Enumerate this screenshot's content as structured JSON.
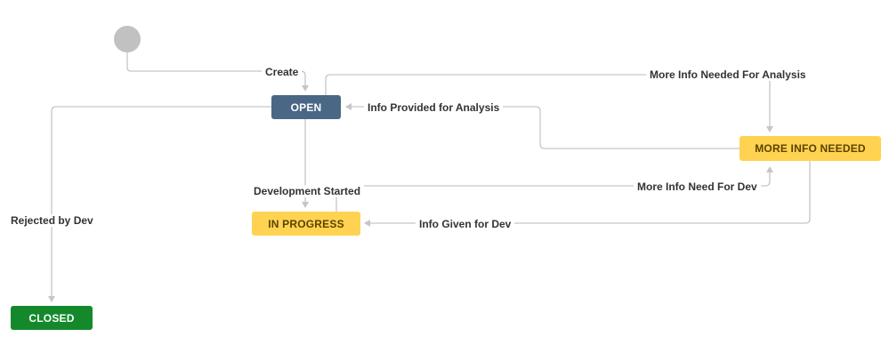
{
  "diagram": {
    "start_node": {
      "icon": "start-circle"
    },
    "statuses": {
      "open": {
        "label": "OPEN",
        "color": "#4a6785"
      },
      "more_info_needed": {
        "label": "MORE INFO NEEDED",
        "color": "#ffd351"
      },
      "in_progress": {
        "label": "IN PROGRESS",
        "color": "#ffd351"
      },
      "closed": {
        "label": "CLOSED",
        "color": "#14892c"
      }
    },
    "transitions": {
      "create": {
        "label": "Create",
        "from": "start",
        "to": "OPEN"
      },
      "more_info_needed_for_analysis": {
        "label": "More Info Needed For Analysis",
        "from": "OPEN",
        "to": "MORE INFO NEEDED"
      },
      "info_provided_for_analysis": {
        "label": "Info Provided for Analysis",
        "from": "MORE INFO NEEDED",
        "to": "OPEN"
      },
      "development_started": {
        "label": "Development Started",
        "from": "OPEN",
        "to": "IN PROGRESS"
      },
      "more_info_need_for_dev": {
        "label": "More Info Need For Dev",
        "from": "IN PROGRESS",
        "to": "MORE INFO NEEDED"
      },
      "info_given_for_dev": {
        "label": "Info Given for Dev",
        "from": "MORE INFO NEEDED",
        "to": "IN PROGRESS"
      },
      "rejected_by_dev": {
        "label": "Rejected by Dev",
        "from": "OPEN",
        "to": "CLOSED"
      }
    },
    "colors": {
      "connector": "#c6c6c6",
      "label_text": "#333333",
      "start_circle": "#c1c1c1"
    }
  }
}
